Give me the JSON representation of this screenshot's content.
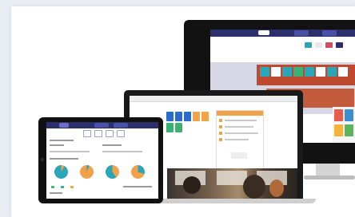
{
  "scene": {
    "description_free": true,
    "colors": {
      "page_background": "#e9eef4",
      "panel": "#ffffff",
      "device_black": "#121212",
      "nav_navy": "#2b2f6b",
      "accent_orange": "#f1a24b",
      "accent_teal": "#2aa6b8",
      "accent_red": "#bf4a30"
    },
    "icons": [
      "desktop-monitor",
      "laptop",
      "tablet"
    ]
  }
}
